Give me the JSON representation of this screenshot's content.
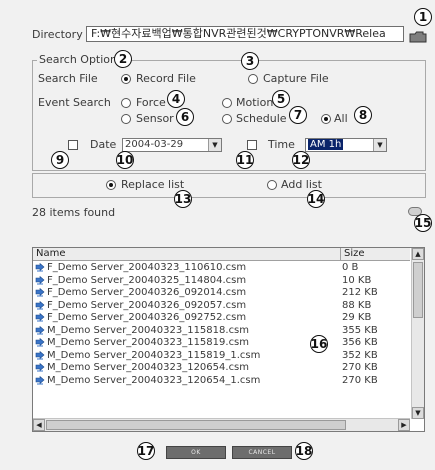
{
  "directory": {
    "label": "Directory :",
    "path": "F:₩현수자료백업₩통합NVR관련된것₩CRYPTONVR₩Relea"
  },
  "search_option": {
    "legend": "Search Option",
    "search_file_label": "Search File",
    "record_file": "Record File",
    "capture_file": "Capture File",
    "event_search_label": "Event Search",
    "force": "Force",
    "motion": "Motion",
    "sensor": "Sensor",
    "schedule": "Schedule",
    "all": "All",
    "date_label": "Date",
    "date_value": "2004-03-29",
    "time_label": "Time",
    "time_value": "AM 1h"
  },
  "list_mode": {
    "replace": "Replace list",
    "add": "Add list"
  },
  "items_found": "28 items found",
  "table": {
    "col_name": "Name",
    "col_size": "Size",
    "rows": [
      {
        "name": "F_Demo Server_20040323_110610.csm",
        "size": "0 B"
      },
      {
        "name": "F_Demo Server_20040325_114804.csm",
        "size": "10 KB"
      },
      {
        "name": "F_Demo Server_20040326_092014.csm",
        "size": "212 KB"
      },
      {
        "name": "F_Demo Server_20040326_092057.csm",
        "size": "88 KB"
      },
      {
        "name": "F_Demo Server_20040326_092752.csm",
        "size": "29 KB"
      },
      {
        "name": "M_Demo Server_20040323_115818.csm",
        "size": "355 KB"
      },
      {
        "name": "M_Demo Server_20040323_115819.csm",
        "size": "356 KB"
      },
      {
        "name": "M_Demo Server_20040323_115819_1.csm",
        "size": "352 KB"
      },
      {
        "name": "M_Demo Server_20040323_120654.csm",
        "size": "270 KB"
      },
      {
        "name": "M_Demo Server_20040323_120654_1.csm",
        "size": "270 KB"
      }
    ]
  },
  "buttons": {
    "ok": "OK",
    "cancel": "CANCEL"
  },
  "callouts": [
    "1",
    "2",
    "3",
    "4",
    "5",
    "6",
    "7",
    "8",
    "9",
    "10",
    "11",
    "12",
    "13",
    "14",
    "15",
    "16",
    "17",
    "18"
  ]
}
